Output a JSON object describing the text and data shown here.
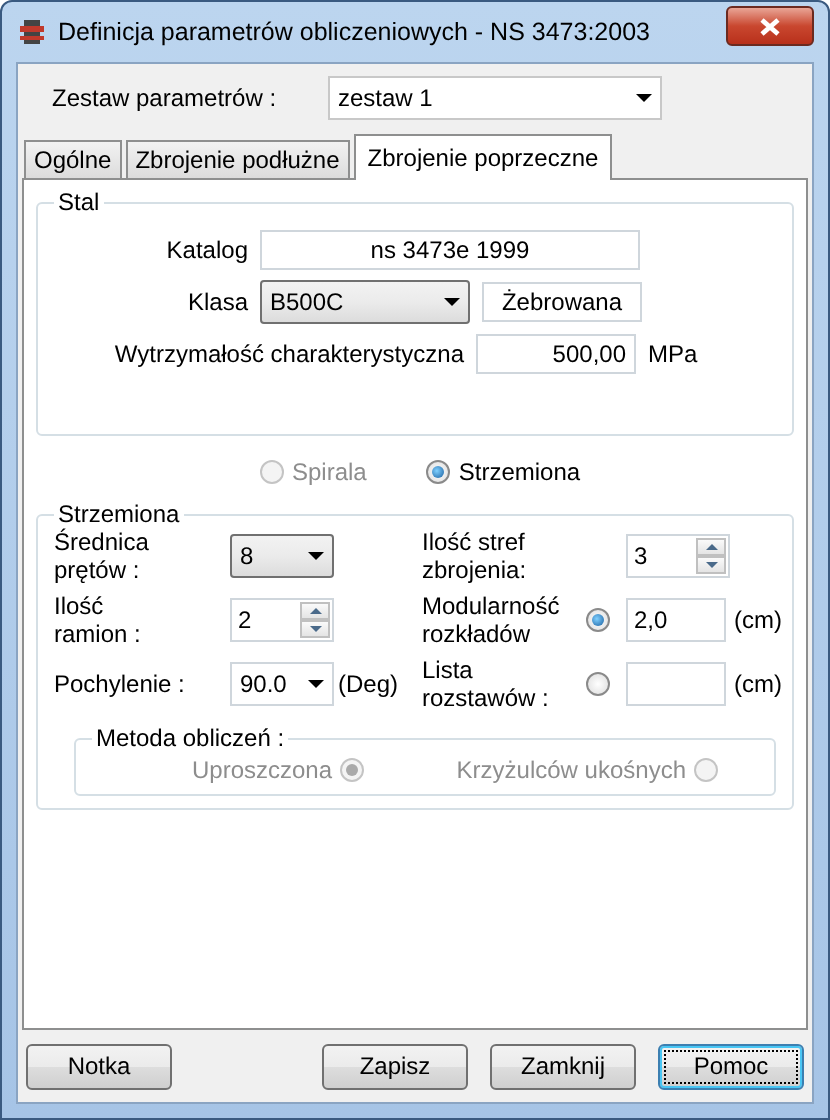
{
  "window": {
    "title": "Definicja parametrów obliczeniowych - NS 3473:2003"
  },
  "parameter_set": {
    "label": "Zestaw parametrów :",
    "value": "zestaw 1"
  },
  "tabs": [
    {
      "label": "Ogólne",
      "selected": false
    },
    {
      "label": "Zbrojenie podłużne",
      "selected": false
    },
    {
      "label": "Zbrojenie poprzeczne",
      "selected": true
    }
  ],
  "steel": {
    "title": "Stal",
    "catalog_label": "Katalog",
    "catalog": "ns 3473e 1999",
    "class_label": "Klasa",
    "class": "B500C",
    "surface": "Żebrowana",
    "strength_label": "Wytrzymałość charakterystyczna",
    "strength": "500,00",
    "strength_unit": "MPa"
  },
  "reinforcement_type": [
    {
      "label": "Spirala",
      "selected": false,
      "disabled": true
    },
    {
      "label": "Strzemiona",
      "selected": true,
      "disabled": false
    }
  ],
  "stirrups": {
    "title": "Strzemiona",
    "diameter": {
      "label": "Średnica prętów :",
      "value": "8"
    },
    "legs": {
      "label": "Ilość ramion :",
      "value": "2"
    },
    "inclination": {
      "label": "Pochylenie :",
      "value": "90.0",
      "unit": "(Deg)"
    },
    "zones": {
      "label": "Ilość stref zbrojenia:",
      "value": "3"
    },
    "spacing_options": [
      {
        "label": "Modularność rozkładów",
        "selected": true,
        "value": "2,0",
        "unit": "(cm)"
      },
      {
        "label": "Lista rozstawów :",
        "selected": false,
        "unit": "(cm)"
      }
    ]
  },
  "method": {
    "title": "Metoda obliczeń :",
    "options": [
      {
        "label": "Uproszczona",
        "selected": true,
        "disabled": true
      },
      {
        "label": "Krzyżulców ukośnych",
        "selected": false,
        "disabled": true
      }
    ]
  },
  "buttons": [
    {
      "label": "Notka",
      "focused": false
    },
    {
      "label": "Zapisz",
      "focused": false
    },
    {
      "label": "Zamknij",
      "focused": false
    },
    {
      "label": "Pomoc",
      "focused": true
    }
  ]
}
